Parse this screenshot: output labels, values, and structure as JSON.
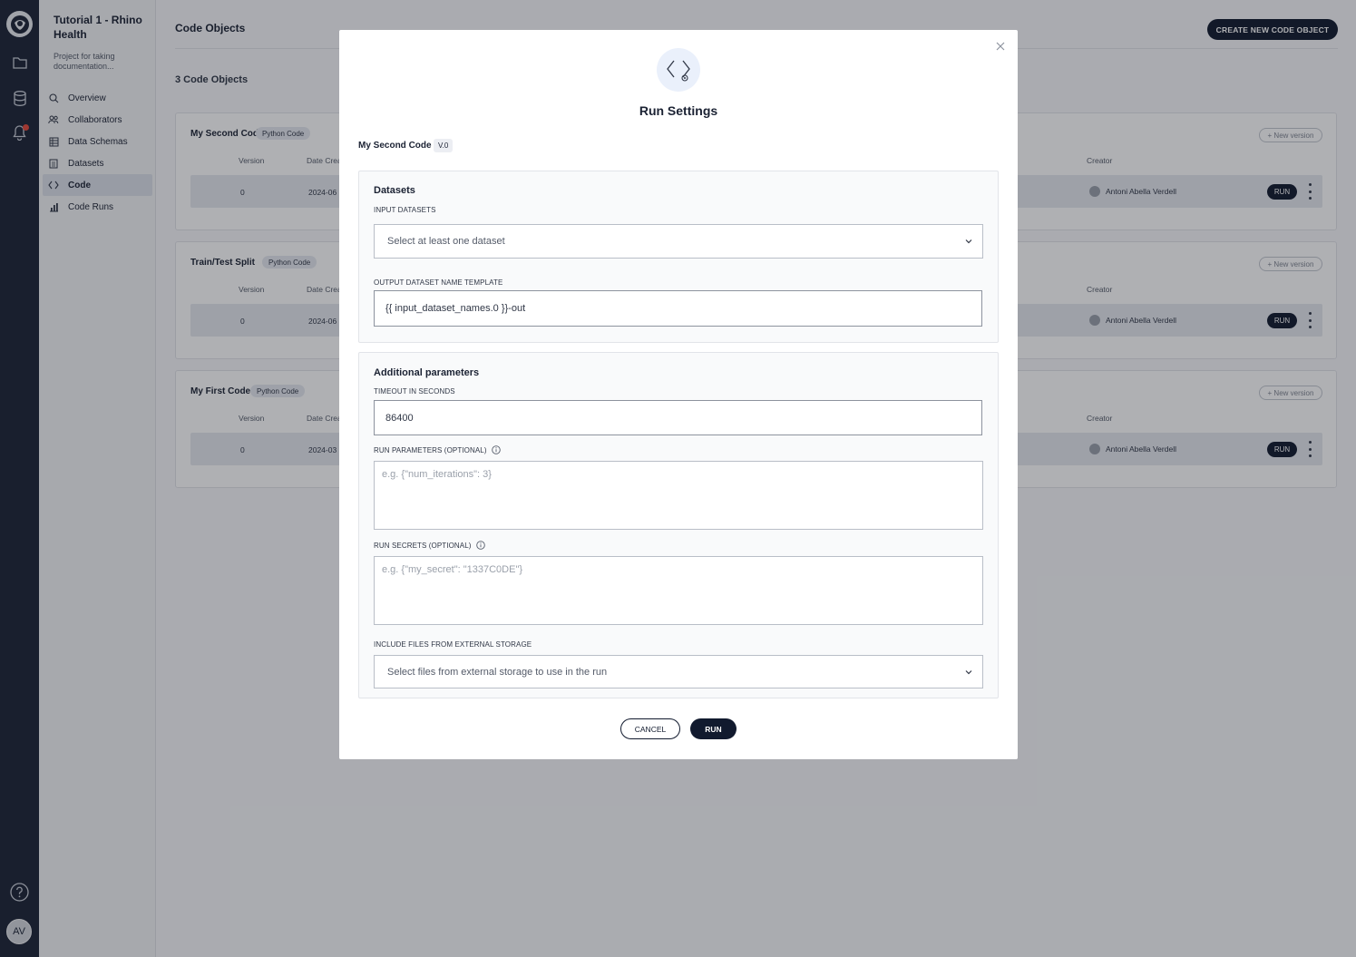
{
  "project": {
    "title": "Tutorial 1 - Rhino Health",
    "description": "Project for taking documentation..."
  },
  "rail": {
    "icons": [
      "rhino-logo-icon",
      "folder-icon",
      "database-icon",
      "bell-icon",
      "help-icon"
    ],
    "avatar_initials": "AV"
  },
  "nav": {
    "items": [
      {
        "label": "Overview",
        "icon": "overview-icon"
      },
      {
        "label": "Collaborators",
        "icon": "collaborators-icon"
      },
      {
        "label": "Data Schemas",
        "icon": "schema-icon"
      },
      {
        "label": "Datasets",
        "icon": "datasets-icon"
      },
      {
        "label": "Code",
        "icon": "code-icon",
        "active": true
      },
      {
        "label": "Code Runs",
        "icon": "chart-icon"
      }
    ]
  },
  "page": {
    "title": "Code Objects",
    "create_button": "CREATE NEW CODE OBJECT",
    "count_label": "3 Code Objects"
  },
  "code_objects": [
    {
      "name": "My Second Code",
      "type": "Python Code",
      "new_version": "+ New version",
      "columns": {
        "version": "Version",
        "date": "Date Crea",
        "creator": "Creator"
      },
      "row": {
        "version": "0",
        "date": "2024-06",
        "creator": "Antoni Abella Verdell",
        "run": "RUN"
      }
    },
    {
      "name": "Train/Test Split",
      "type": "Python Code",
      "new_version": "+ New version",
      "columns": {
        "version": "Version",
        "date": "Date Crea",
        "creator": "Creator"
      },
      "row": {
        "version": "0",
        "date": "2024-06",
        "creator": "Antoni Abella Verdell",
        "run": "RUN"
      }
    },
    {
      "name": "My First Code",
      "type": "Python Code",
      "new_version": "+ New version",
      "columns": {
        "version": "Version",
        "date": "Date Crea",
        "creator": "Creator"
      },
      "row": {
        "version": "0",
        "date": "2024-03",
        "creator": "Antoni Abella Verdell",
        "run": "RUN"
      }
    }
  ],
  "modal": {
    "title": "Run Settings",
    "code_name": "My Second Code",
    "version": "V.0",
    "datasets": {
      "title": "Datasets",
      "input_label": "INPUT DATASETS",
      "input_placeholder": "Select at least one dataset",
      "output_label": "OUTPUT DATASET NAME TEMPLATE",
      "output_value": "{{ input_dataset_names.0 }}-out"
    },
    "additional": {
      "title": "Additional parameters",
      "timeout_label": "TIMEOUT IN SECONDS",
      "timeout_value": "86400",
      "params_label": "RUN PARAMETERS (OPTIONAL)",
      "params_placeholder": "e.g. {\"num_iterations\": 3}",
      "secrets_label": "RUN SECRETS (OPTIONAL)",
      "secrets_placeholder": "e.g. {\"my_secret\": \"1337C0DE\"}",
      "storage_label": "INCLUDE FILES FROM EXTERNAL STORAGE",
      "storage_placeholder": "Select files from external storage to use in the run"
    },
    "cancel_label": "CANCEL",
    "run_label": "RUN"
  },
  "colors": {
    "rail": "#1c2436",
    "primary_button": "#111a2e",
    "notification": "#e5483b",
    "active_nav": "#dde1ea"
  }
}
